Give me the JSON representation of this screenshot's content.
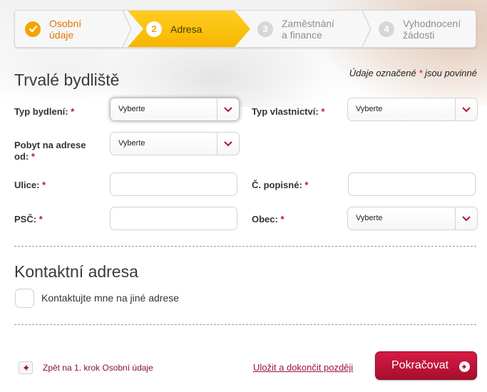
{
  "stepper": {
    "steps": [
      {
        "number": "✓",
        "label_line1": "Osobní",
        "label_line2": "údaje",
        "state": "completed"
      },
      {
        "number": "2",
        "label_line1": "Adresa",
        "label_line2": "",
        "state": "active"
      },
      {
        "number": "3",
        "label_line1": "Zaměstnání",
        "label_line2": "a finance",
        "state": "upcoming"
      },
      {
        "number": "4",
        "label_line1": "Vyhodnocení",
        "label_line2": "žádosti",
        "state": "upcoming"
      }
    ]
  },
  "required_note": {
    "before": "Údaje označené ",
    "star": "*",
    "after": " jsou povinné"
  },
  "permanent_address": {
    "title": "Trvalé bydliště",
    "housing_type": {
      "label": "Typ bydlení:",
      "star": "*",
      "value": "Vyberte"
    },
    "ownership_type": {
      "label": "Typ vlastnictví:",
      "star": "*",
      "value": "Vyberte"
    },
    "stay_since": {
      "label_line1": "Pobyt na adrese",
      "label_line2": "od:",
      "star": "*",
      "value": "Vyberte"
    },
    "street": {
      "label": "Ulice:",
      "star": "*",
      "value": ""
    },
    "house_number": {
      "label": "Č. popisné:",
      "star": "*",
      "value": ""
    },
    "zip": {
      "label": "PSČ:",
      "star": "*",
      "value": ""
    },
    "city": {
      "label": "Obec:",
      "star": "*",
      "value": "Vyberte"
    }
  },
  "contact_address": {
    "title": "Kontaktní adresa",
    "checkbox_label": "Kontaktujte mne na jiné adrese",
    "checked": false
  },
  "footer": {
    "back_label": "Zpět na 1. krok Osobní údaje",
    "save_label": "Uložit a dokončit později",
    "continue_label": "Pokračovat"
  },
  "colors": {
    "accent": "#c8102e",
    "active_step": "#f7b600",
    "completed_step": "#f5a300"
  }
}
